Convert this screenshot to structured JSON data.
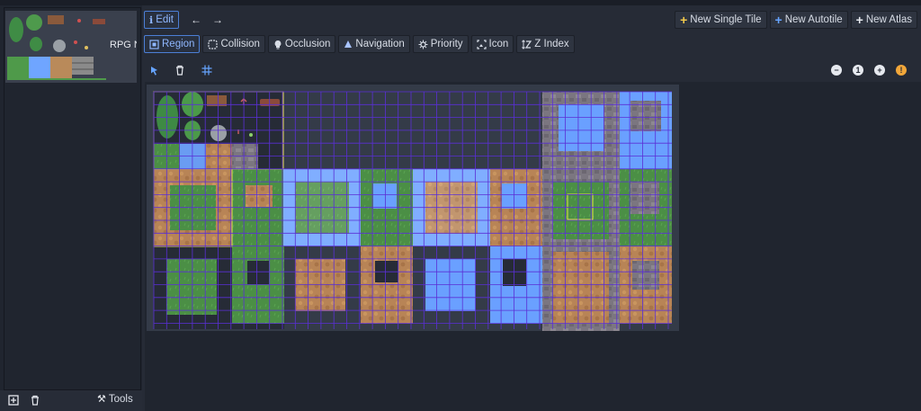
{
  "left_panel": {
    "thumbnail_label": "RPG N",
    "bottom": {
      "add_label": "+",
      "remove_label": "🗑",
      "tools_label": "Tools"
    }
  },
  "toolbar": {
    "edit_label": "Edit",
    "prev_icon": "arrow-left-icon",
    "next_icon": "arrow-right-icon",
    "new_single_tile": "New Single Tile",
    "new_autotile": "New Autotile",
    "new_atlas": "New Atlas"
  },
  "modes": [
    {
      "label": "Region",
      "icon": "region-icon",
      "active": true
    },
    {
      "label": "Collision",
      "icon": "collision-icon",
      "active": false
    },
    {
      "label": "Occlusion",
      "icon": "occlusion-icon",
      "active": false
    },
    {
      "label": "Navigation",
      "icon": "navigation-icon",
      "active": false
    },
    {
      "label": "Priority",
      "icon": "priority-icon",
      "active": false
    },
    {
      "label": "Icon",
      "icon": "icon-mode-icon",
      "active": false
    },
    {
      "label": "Z Index",
      "icon": "z-index-icon",
      "active": false
    }
  ],
  "tools": {
    "select_icon": "cursor-icon",
    "delete_icon": "trash-icon",
    "grid_icon": "grid-snap-icon",
    "zoom_out": "−",
    "zoom_reset": "1",
    "zoom_in": "+",
    "warning": "!"
  },
  "colors": {
    "accent": "#4c7fd6",
    "grid": "#5a2fd6",
    "selection": "#e6e04a",
    "new_single_tile_plus": "#f2c94c",
    "new_autotile_plus": "#66a4ff"
  }
}
